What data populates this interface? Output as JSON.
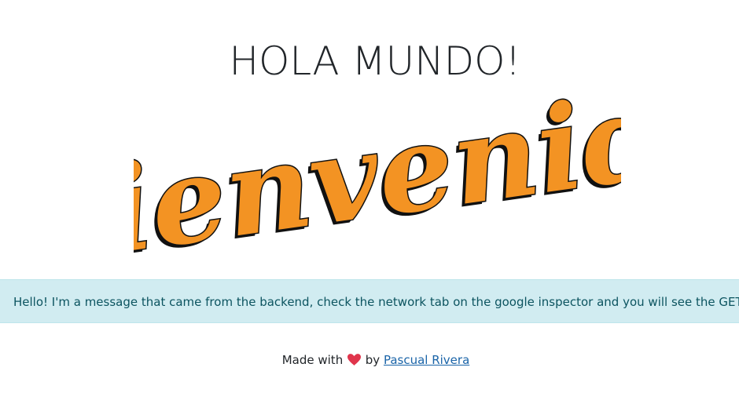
{
  "header": {
    "title": "HOLA MUNDO!"
  },
  "hero": {
    "image_text": "¡Bienvenido!",
    "colors": {
      "fill": "#f39323",
      "shadow": "#111111"
    }
  },
  "alert": {
    "message": "Hello! I'm a message that came from the backend, check the network tab on the google inspector and you will see the GET request",
    "colors": {
      "background": "#d1ecf1",
      "border": "#bee5eb",
      "text": "#0c5460"
    }
  },
  "footer": {
    "prefix": "Made with",
    "heart_icon": "heart-icon",
    "by": "by",
    "author": "Pascual Rivera",
    "colors": {
      "heart": "#e0354c",
      "link": "#1a64a8"
    }
  }
}
